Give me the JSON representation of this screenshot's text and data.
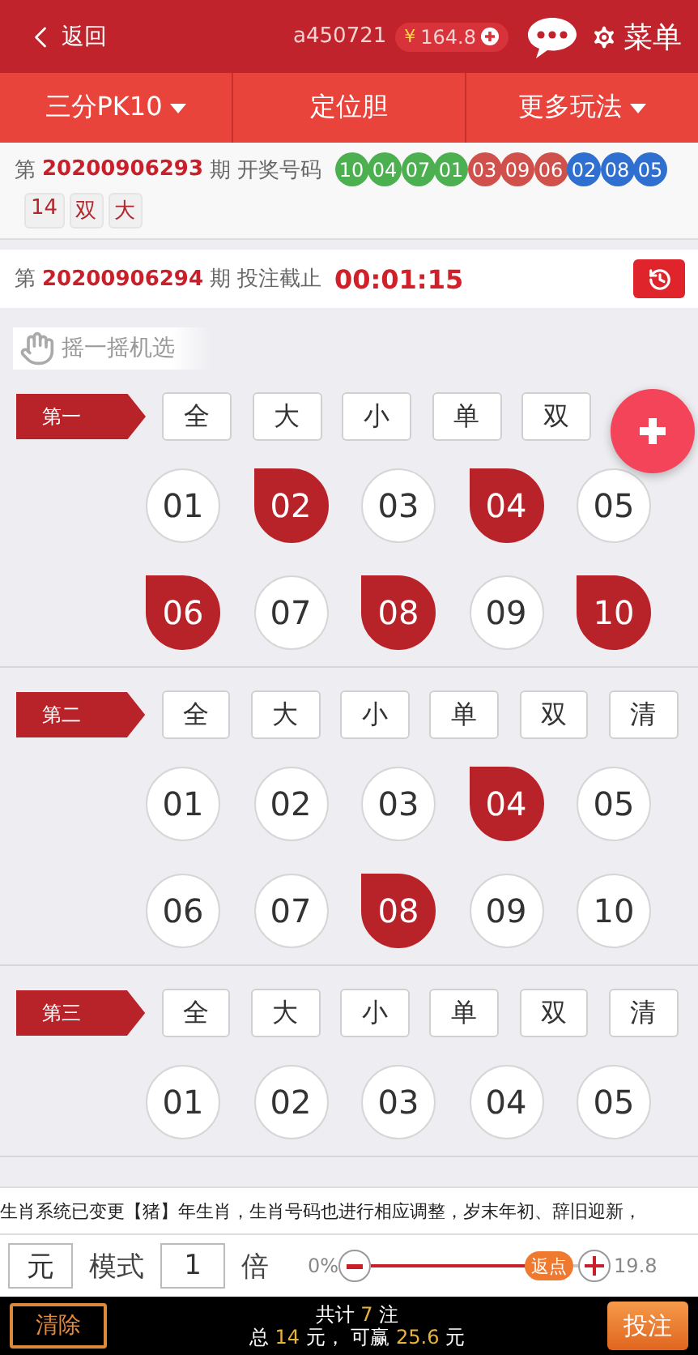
{
  "header": {
    "back_label": "返回",
    "username": "a450721",
    "currency": "¥",
    "balance": "164.8",
    "menu_label": "菜单"
  },
  "tabs": [
    {
      "label": "三分PK10",
      "dropdown": true
    },
    {
      "label": "定位胆",
      "dropdown": false
    },
    {
      "label": "更多玩法",
      "dropdown": true
    }
  ],
  "last_draw": {
    "prefix": "第",
    "issue": "20200906293",
    "suffix": "期",
    "label": "开奖号码",
    "balls": [
      {
        "number": "10",
        "color": "#4caf50"
      },
      {
        "number": "04",
        "color": "#4caf50"
      },
      {
        "number": "07",
        "color": "#4caf50"
      },
      {
        "number": "01",
        "color": "#4caf50"
      },
      {
        "number": "03",
        "color": "#d0504c"
      },
      {
        "number": "09",
        "color": "#d0504c"
      },
      {
        "number": "06",
        "color": "#d0504c"
      },
      {
        "number": "02",
        "color": "#2f6fd0"
      },
      {
        "number": "08",
        "color": "#2f6fd0"
      },
      {
        "number": "05",
        "color": "#2f6fd0"
      }
    ],
    "tags": [
      "14",
      "双",
      "大"
    ]
  },
  "current": {
    "prefix": "第",
    "issue": "20200906294",
    "suffix": "期",
    "label": "投注截止",
    "countdown": "00:01:15"
  },
  "shake_label": "摇一摇机选",
  "positions": [
    {
      "label": "第一",
      "quick": [
        "全",
        "大",
        "小",
        "单",
        "双"
      ],
      "numbers": [
        {
          "n": "01",
          "selected": false
        },
        {
          "n": "02",
          "selected": true
        },
        {
          "n": "03",
          "selected": false
        },
        {
          "n": "04",
          "selected": true
        },
        {
          "n": "05",
          "selected": false
        },
        {
          "n": "06",
          "selected": true
        },
        {
          "n": "07",
          "selected": false
        },
        {
          "n": "08",
          "selected": true
        },
        {
          "n": "09",
          "selected": false
        },
        {
          "n": "10",
          "selected": true
        }
      ]
    },
    {
      "label": "第二",
      "quick": [
        "全",
        "大",
        "小",
        "单",
        "双",
        "清"
      ],
      "numbers": [
        {
          "n": "01",
          "selected": false
        },
        {
          "n": "02",
          "selected": false
        },
        {
          "n": "03",
          "selected": false
        },
        {
          "n": "04",
          "selected": true
        },
        {
          "n": "05",
          "selected": false
        },
        {
          "n": "06",
          "selected": false
        },
        {
          "n": "07",
          "selected": false
        },
        {
          "n": "08",
          "selected": true
        },
        {
          "n": "09",
          "selected": false
        },
        {
          "n": "10",
          "selected": false
        }
      ]
    },
    {
      "label": "第三",
      "quick": [
        "全",
        "大",
        "小",
        "单",
        "双",
        "清"
      ],
      "numbers": [
        {
          "n": "01",
          "selected": false
        },
        {
          "n": "02",
          "selected": false
        },
        {
          "n": "03",
          "selected": false
        },
        {
          "n": "04",
          "selected": false
        },
        {
          "n": "05",
          "selected": false
        }
      ]
    }
  ],
  "notice": "生肖系统已变更【猪】年生肖，生肖号码也进行相应调整，岁末年初、辞旧迎新，",
  "controls": {
    "unit": "元",
    "mode_label": "模式",
    "multiplier": "1",
    "multiplier_unit": "倍",
    "rebate_min": "0%",
    "slider": {
      "level": 0.86,
      "thumb_label": "返点"
    },
    "rebate_max": "19.8"
  },
  "footer": {
    "clear": "清除",
    "line1": [
      "共计",
      "7",
      "注"
    ],
    "line2": [
      "总",
      "14",
      "元，",
      "可赢",
      "25.6",
      "元"
    ],
    "submit": "投注"
  }
}
